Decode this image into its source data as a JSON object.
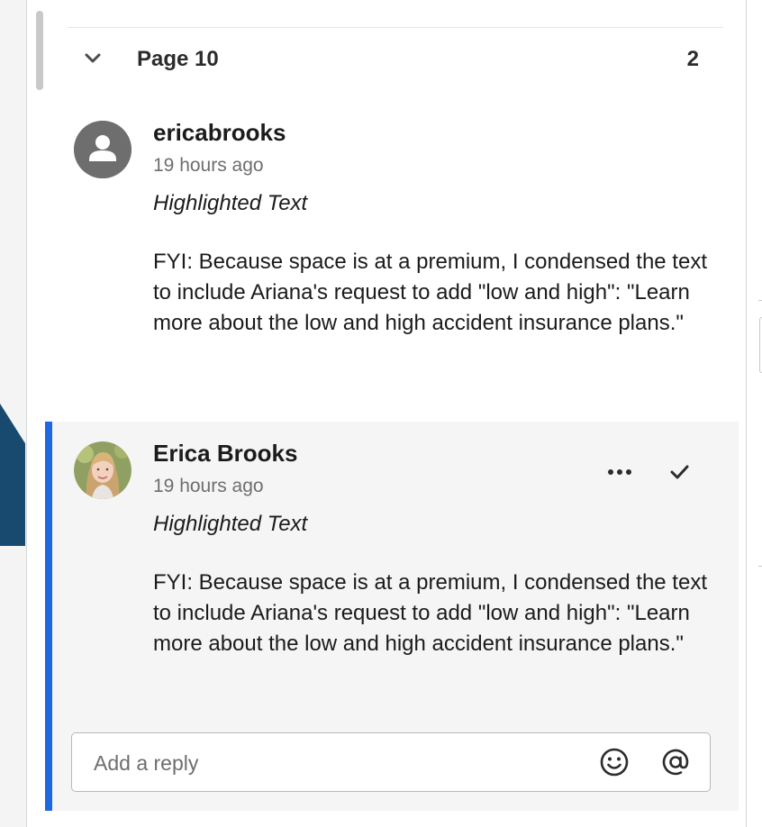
{
  "section": {
    "title": "Page 10",
    "count": "2"
  },
  "comments": [
    {
      "author": "ericabrooks",
      "time": "19 hours ago",
      "type": "Highlighted Text",
      "body": "FYI: Because space is at a premium, I condensed the text to include Ariana's request to add \"low and high\": \"Learn more about the low and high accident insurance plans.\"",
      "avatar": "default-user-icon"
    },
    {
      "author": "Erica Brooks",
      "time": "19 hours ago",
      "type": "Highlighted Text",
      "body": "FYI: Because space is at a premium, I condensed the text to include Ariana's request to add \"low and high\": \"Learn more about the low and high accident insurance plans.\"",
      "avatar": "profile-photo",
      "selected": true
    }
  ],
  "actions": {
    "more_icon": "more-horizontal-icon",
    "resolve_icon": "checkmark-icon"
  },
  "reply": {
    "placeholder": "Add a reply",
    "emoji_icon": "emoji-icon",
    "mention_icon": "at-mention-icon"
  },
  "colors": {
    "selection_accent": "#1f68e0",
    "selected_bg": "#f5f5f5",
    "doc_peek": "#184a70"
  }
}
